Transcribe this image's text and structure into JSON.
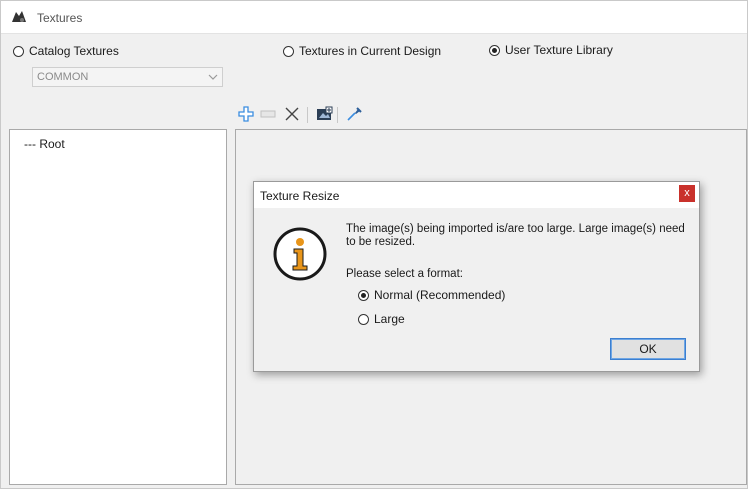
{
  "window": {
    "title": "Textures",
    "icon": "textures-app-icon"
  },
  "source_options": {
    "catalog": {
      "label": "Catalog Textures",
      "selected": false
    },
    "current_design": {
      "label": "Textures in Current Design",
      "selected": false
    },
    "user_library": {
      "label": "User Texture Library",
      "selected": true
    }
  },
  "catalog_combo": {
    "value": "COMMON",
    "icon": "chevron-down-icon"
  },
  "toolbar": {
    "icons": [
      "add-icon",
      "rename-icon",
      "delete-icon",
      "import-image-icon",
      "eyedropper-icon"
    ]
  },
  "tree": {
    "root_label": "--- Root"
  },
  "dialog": {
    "title": "Texture Resize",
    "close_label": "x",
    "icon": "info-icon",
    "message": "The image(s) being imported is/are too large. Large image(s) need to be resized.",
    "prompt": "Please select a format:",
    "options": [
      {
        "label": "Normal (Recommended)",
        "selected": true
      },
      {
        "label": "Large",
        "selected": false
      }
    ],
    "ok_label": "OK"
  },
  "colors": {
    "accent_close": "#c9312b",
    "info_orange": "#e8951a",
    "add_blue": "#3a8de0"
  }
}
